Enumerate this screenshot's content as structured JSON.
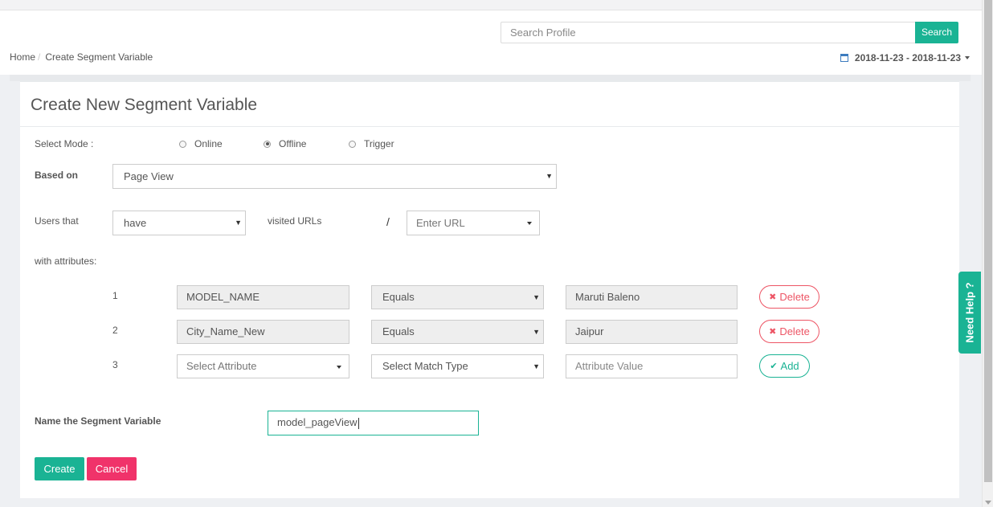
{
  "header": {
    "search_placeholder": "Search Profile",
    "search_button": "Search",
    "breadcrumb": {
      "home": "Home",
      "separator": "/",
      "current": "Create Segment Variable"
    },
    "date_range": "2018-11-23 - 2018-11-23"
  },
  "form": {
    "title": "Create New Segment Variable",
    "select_mode_label": "Select Mode :",
    "modes": [
      {
        "label": "Online",
        "selected": false
      },
      {
        "label": "Offline",
        "selected": true
      },
      {
        "label": "Trigger",
        "selected": false
      }
    ],
    "based_on_label": "Based on",
    "based_on_value": "Page View",
    "users_that_label": "Users that",
    "users_that_value": "have",
    "visited_urls_label": "visited URLs",
    "slash": "/",
    "url_placeholder": "Enter URL",
    "with_attributes_label": "with attributes:",
    "attributes": [
      {
        "index": "1",
        "attribute": "MODEL_NAME",
        "match": "Equals",
        "value": "Maruti Baleno",
        "action": "Delete"
      },
      {
        "index": "2",
        "attribute": "City_Name_New",
        "match": "Equals",
        "value": "Jaipur",
        "action": "Delete"
      },
      {
        "index": "3",
        "attribute": "Select Attribute",
        "match": "Select Match Type",
        "value": "Attribute Value",
        "action": "Add"
      }
    ],
    "name_label": "Name the Segment Variable",
    "name_value": "model_pageView",
    "create_button": "Create",
    "cancel_button": "Cancel"
  },
  "help_tab": "Need Help ?",
  "colors": {
    "accent": "#1ab394",
    "danger": "#ed5565",
    "cancel": "#f0336a"
  }
}
